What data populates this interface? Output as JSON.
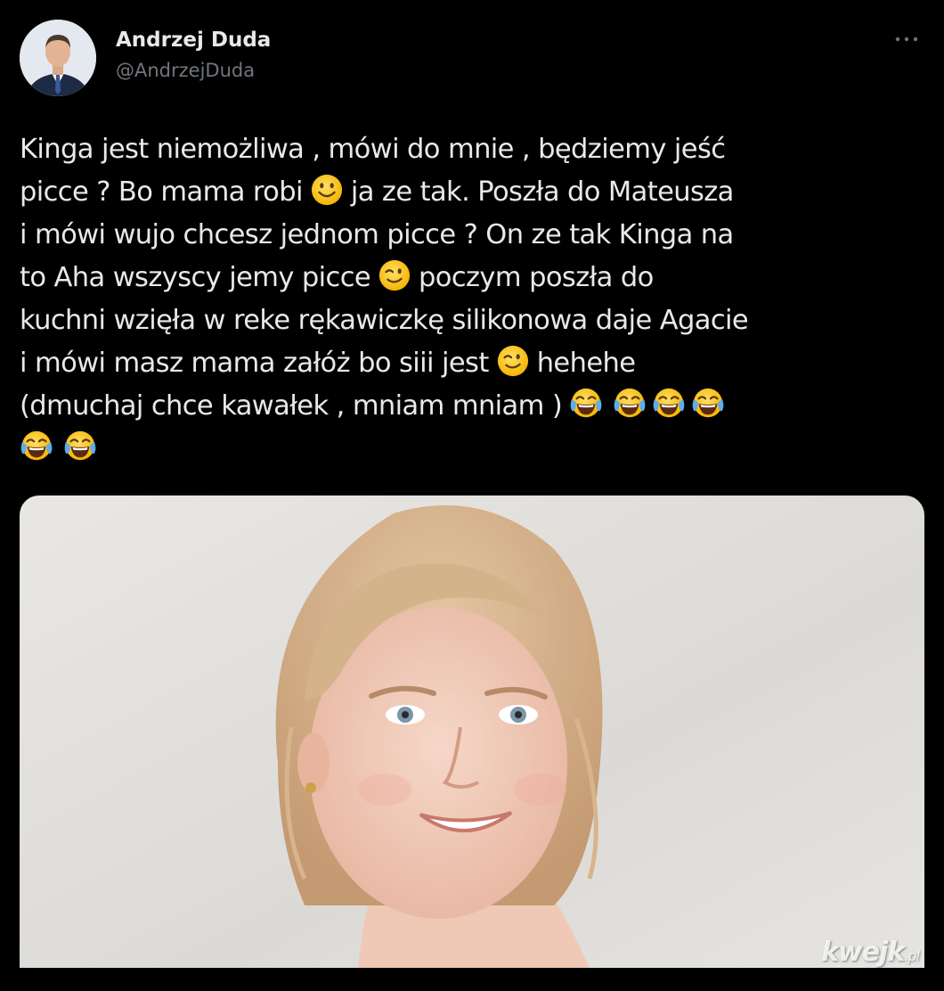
{
  "author": {
    "display_name": "Andrzej Duda",
    "handle": "@AndrzejDuda"
  },
  "more_icon": "more-horizontal-icon",
  "tweet": {
    "lines": [
      [
        "Kinga jest niemożliwa , mówi do mnie , będziemy jeść"
      ],
      [
        "picce  ? Bo mama robi",
        "ja ze tak. Poszła do Mateusza"
      ],
      [
        "i mówi wujo chcesz jednom picce ? On ze tak Kinga na"
      ],
      [
        "to Aha wszyscy jemy picce",
        "poczym poszła do"
      ],
      [
        "kuchni wzięła w reke rękawiczkę silikonowa daje Agacie"
      ],
      [
        "i mówi masz mama załóż bo siii jest",
        "hehehe"
      ],
      [
        "(dmuchaj chce kawałek , mniam mniam )"
      ]
    ],
    "emojis": {
      "line2": "slightly-smiling-face",
      "line4": "winking-face",
      "line6": "winking-face",
      "line7": [
        "face-with-tears-of-joy",
        "face-with-tears-of-joy",
        "face-with-tears-of-joy",
        "face-with-tears-of-joy"
      ],
      "line8": [
        "face-with-tears-of-joy",
        "face-with-tears-of-joy"
      ]
    }
  },
  "media": {
    "watermark": "kwejk",
    "watermark_suffix": ".pl"
  },
  "colors": {
    "background": "#000000",
    "text": "#e7e9ea",
    "secondary_text": "#71767b",
    "emoji_yellow": "#ffcc33",
    "emoji_tear": "#5dadec"
  }
}
